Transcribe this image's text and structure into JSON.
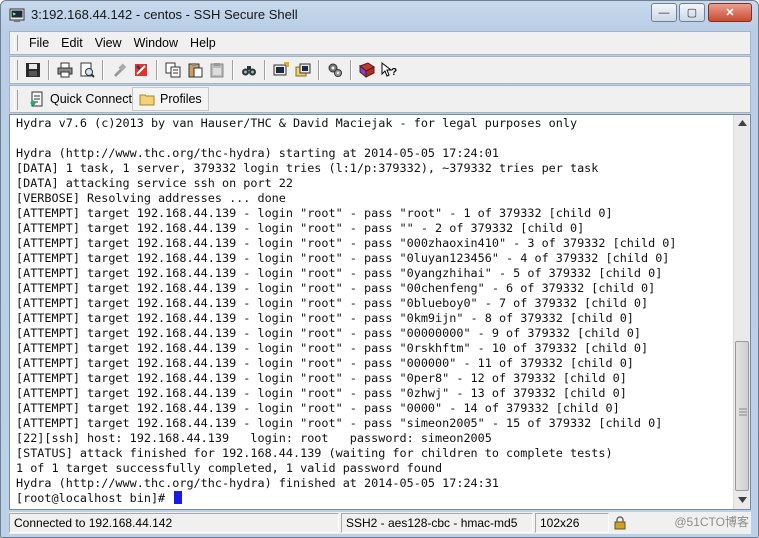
{
  "window": {
    "title": "3:192.168.44.142 - centos - SSH Secure Shell",
    "minimize_label": "—",
    "maximize_label": "▢",
    "close_label": "✕"
  },
  "menu": {
    "items": [
      "File",
      "Edit",
      "View",
      "Window",
      "Help"
    ]
  },
  "toolbar": {
    "icons": [
      "save-icon",
      "print-icon",
      "print-preview-icon",
      "disconnect-icon",
      "settings-icon",
      "copy-icon",
      "paste-icon",
      "paste-disabled-icon",
      "find-icon",
      "new-terminal-icon",
      "new-file-transfer-icon",
      "settings-gear-icon",
      "help-icon",
      "whats-this-icon"
    ]
  },
  "profilebar": {
    "quick_connect": "Quick Connect",
    "profiles": "Profiles"
  },
  "terminal": {
    "lines": [
      "Hydra v7.6 (c)2013 by van Hauser/THC & David Maciejak - for legal purposes only",
      "",
      "Hydra (http://www.thc.org/thc-hydra) starting at 2014-05-05 17:24:01",
      "[DATA] 1 task, 1 server, 379332 login tries (l:1/p:379332), ~379332 tries per task",
      "[DATA] attacking service ssh on port 22",
      "[VERBOSE] Resolving addresses ... done",
      "[ATTEMPT] target 192.168.44.139 - login \"root\" - pass \"root\" - 1 of 379332 [child 0]",
      "[ATTEMPT] target 192.168.44.139 - login \"root\" - pass \"\" - 2 of 379332 [child 0]",
      "[ATTEMPT] target 192.168.44.139 - login \"root\" - pass \"000zhaoxin410\" - 3 of 379332 [child 0]",
      "[ATTEMPT] target 192.168.44.139 - login \"root\" - pass \"0luyan123456\" - 4 of 379332 [child 0]",
      "[ATTEMPT] target 192.168.44.139 - login \"root\" - pass \"0yangzhihai\" - 5 of 379332 [child 0]",
      "[ATTEMPT] target 192.168.44.139 - login \"root\" - pass \"00chenfeng\" - 6 of 379332 [child 0]",
      "[ATTEMPT] target 192.168.44.139 - login \"root\" - pass \"0blueboy0\" - 7 of 379332 [child 0]",
      "[ATTEMPT] target 192.168.44.139 - login \"root\" - pass \"0km9ijn\" - 8 of 379332 [child 0]",
      "[ATTEMPT] target 192.168.44.139 - login \"root\" - pass \"00000000\" - 9 of 379332 [child 0]",
      "[ATTEMPT] target 192.168.44.139 - login \"root\" - pass \"0rskhftm\" - 10 of 379332 [child 0]",
      "[ATTEMPT] target 192.168.44.139 - login \"root\" - pass \"000000\" - 11 of 379332 [child 0]",
      "[ATTEMPT] target 192.168.44.139 - login \"root\" - pass \"0per8\" - 12 of 379332 [child 0]",
      "[ATTEMPT] target 192.168.44.139 - login \"root\" - pass \"0zhwj\" - 13 of 379332 [child 0]",
      "[ATTEMPT] target 192.168.44.139 - login \"root\" - pass \"0000\" - 14 of 379332 [child 0]",
      "[ATTEMPT] target 192.168.44.139 - login \"root\" - pass \"simeon2005\" - 15 of 379332 [child 0]",
      "[22][ssh] host: 192.168.44.139   login: root   password: simeon2005",
      "[STATUS] attack finished for 192.168.44.139 (waiting for children to complete tests)",
      "1 of 1 target successfully completed, 1 valid password found",
      "Hydra (http://www.thc.org/thc-hydra) finished at 2014-05-05 17:24:31"
    ],
    "prompt": "[root@localhost bin]# "
  },
  "statusbar": {
    "connection": "Connected to 192.168.44.142",
    "cipher": "SSH2 - aes128-cbc - hmac-md5",
    "size": "102x26",
    "watermark": "@51CTO博客"
  },
  "colors": {
    "cursor": "#1a1ae6",
    "frame": "#bcd0e8"
  }
}
